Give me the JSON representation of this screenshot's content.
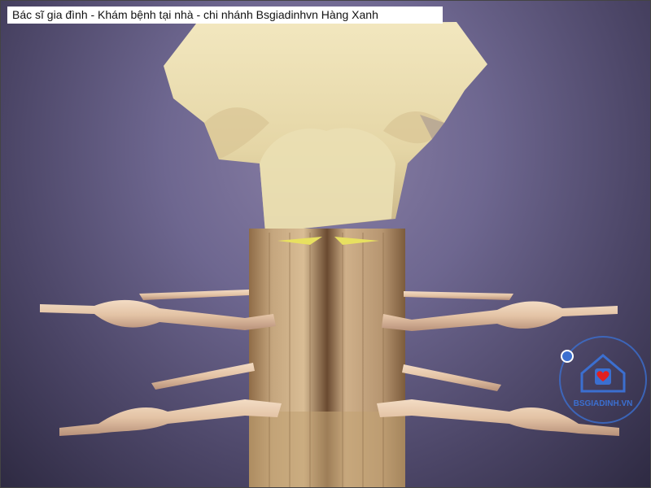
{
  "caption": {
    "text": "Bác sĩ gia đình - Khám bệnh tại nhà - chi nhánh Bsgiadinhvn Hàng Xanh"
  },
  "watermark": {
    "text": "BSGIADINH.VN",
    "color": "#3b6fd0",
    "heart_color": "#e02020"
  },
  "colors": {
    "bone": "#e9dcae",
    "cord": "#c7a77f",
    "nerve": "#e6c9ad",
    "background": "#6e6790"
  },
  "scene": {
    "subject": "vertebra-spinal-cord-nerve-roots"
  }
}
